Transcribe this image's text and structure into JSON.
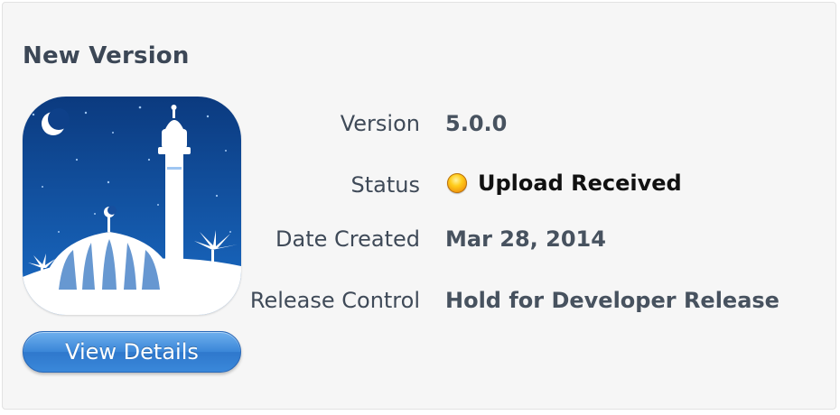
{
  "panel": {
    "title": "New Version"
  },
  "app_icon": {
    "icon_name": "mosque-crescent-app-icon",
    "colors": {
      "sky_top": "#0d3f86",
      "sky_bottom": "#1a6bc4",
      "building": "#ffffff"
    }
  },
  "actions": {
    "view_details_label": "View Details"
  },
  "details": {
    "version": {
      "label": "Version",
      "value": "5.0.0"
    },
    "status": {
      "label": "Status",
      "value": "Upload Received",
      "indicator_color": "#f5a623",
      "indicator_icon": "status-dot-icon"
    },
    "date_created": {
      "label": "Date Created",
      "value": "Mar 28, 2014"
    },
    "release_control": {
      "label": "Release Control",
      "value": "Hold for Developer Release"
    }
  }
}
